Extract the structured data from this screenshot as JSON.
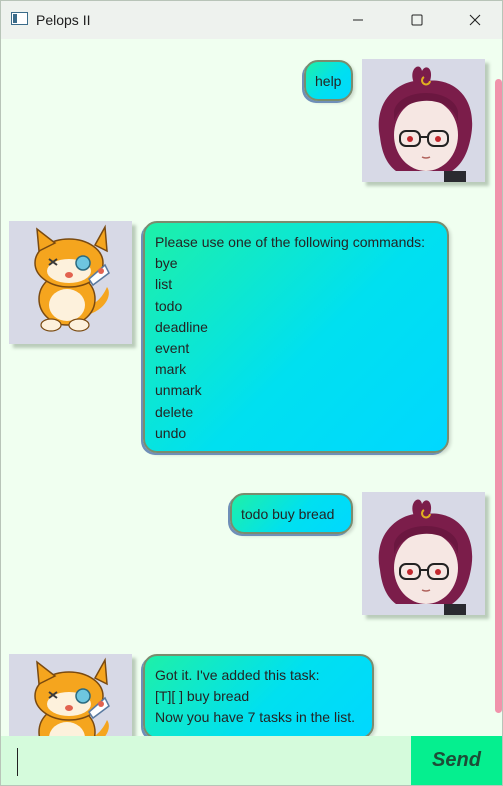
{
  "window": {
    "title": "Pelops II",
    "controls": [
      "minimize-icon",
      "maximize-icon",
      "close-icon"
    ]
  },
  "messages": [
    {
      "sender": "user",
      "avatar": "user-avatar-icon",
      "lines": [
        "help"
      ]
    },
    {
      "sender": "bot",
      "avatar": "bot-avatar-icon",
      "lines": [
        "Please use one of the following commands:",
        "bye",
        "list",
        "todo",
        "deadline",
        "event",
        "mark",
        "unmark",
        "delete",
        "undo"
      ]
    },
    {
      "sender": "user",
      "avatar": "user-avatar-icon",
      "lines": [
        "todo buy bread"
      ]
    },
    {
      "sender": "bot",
      "avatar": "bot-avatar-icon",
      "lines": [
        "Got it. I've added this task:",
        "[T][ ] buy bread",
        "Now you have 7 tasks in the list."
      ]
    }
  ],
  "input": {
    "value": "",
    "placeholder": ""
  },
  "send_button": {
    "label": "Send"
  },
  "colors": {
    "background": "#f0fff0",
    "scrollbar": "#f193ab",
    "input_field": "#d5fbdc",
    "send_button": "#05ef8f",
    "bubble_start": "#1ef0a8",
    "bubble_end": "#00d8ff"
  }
}
